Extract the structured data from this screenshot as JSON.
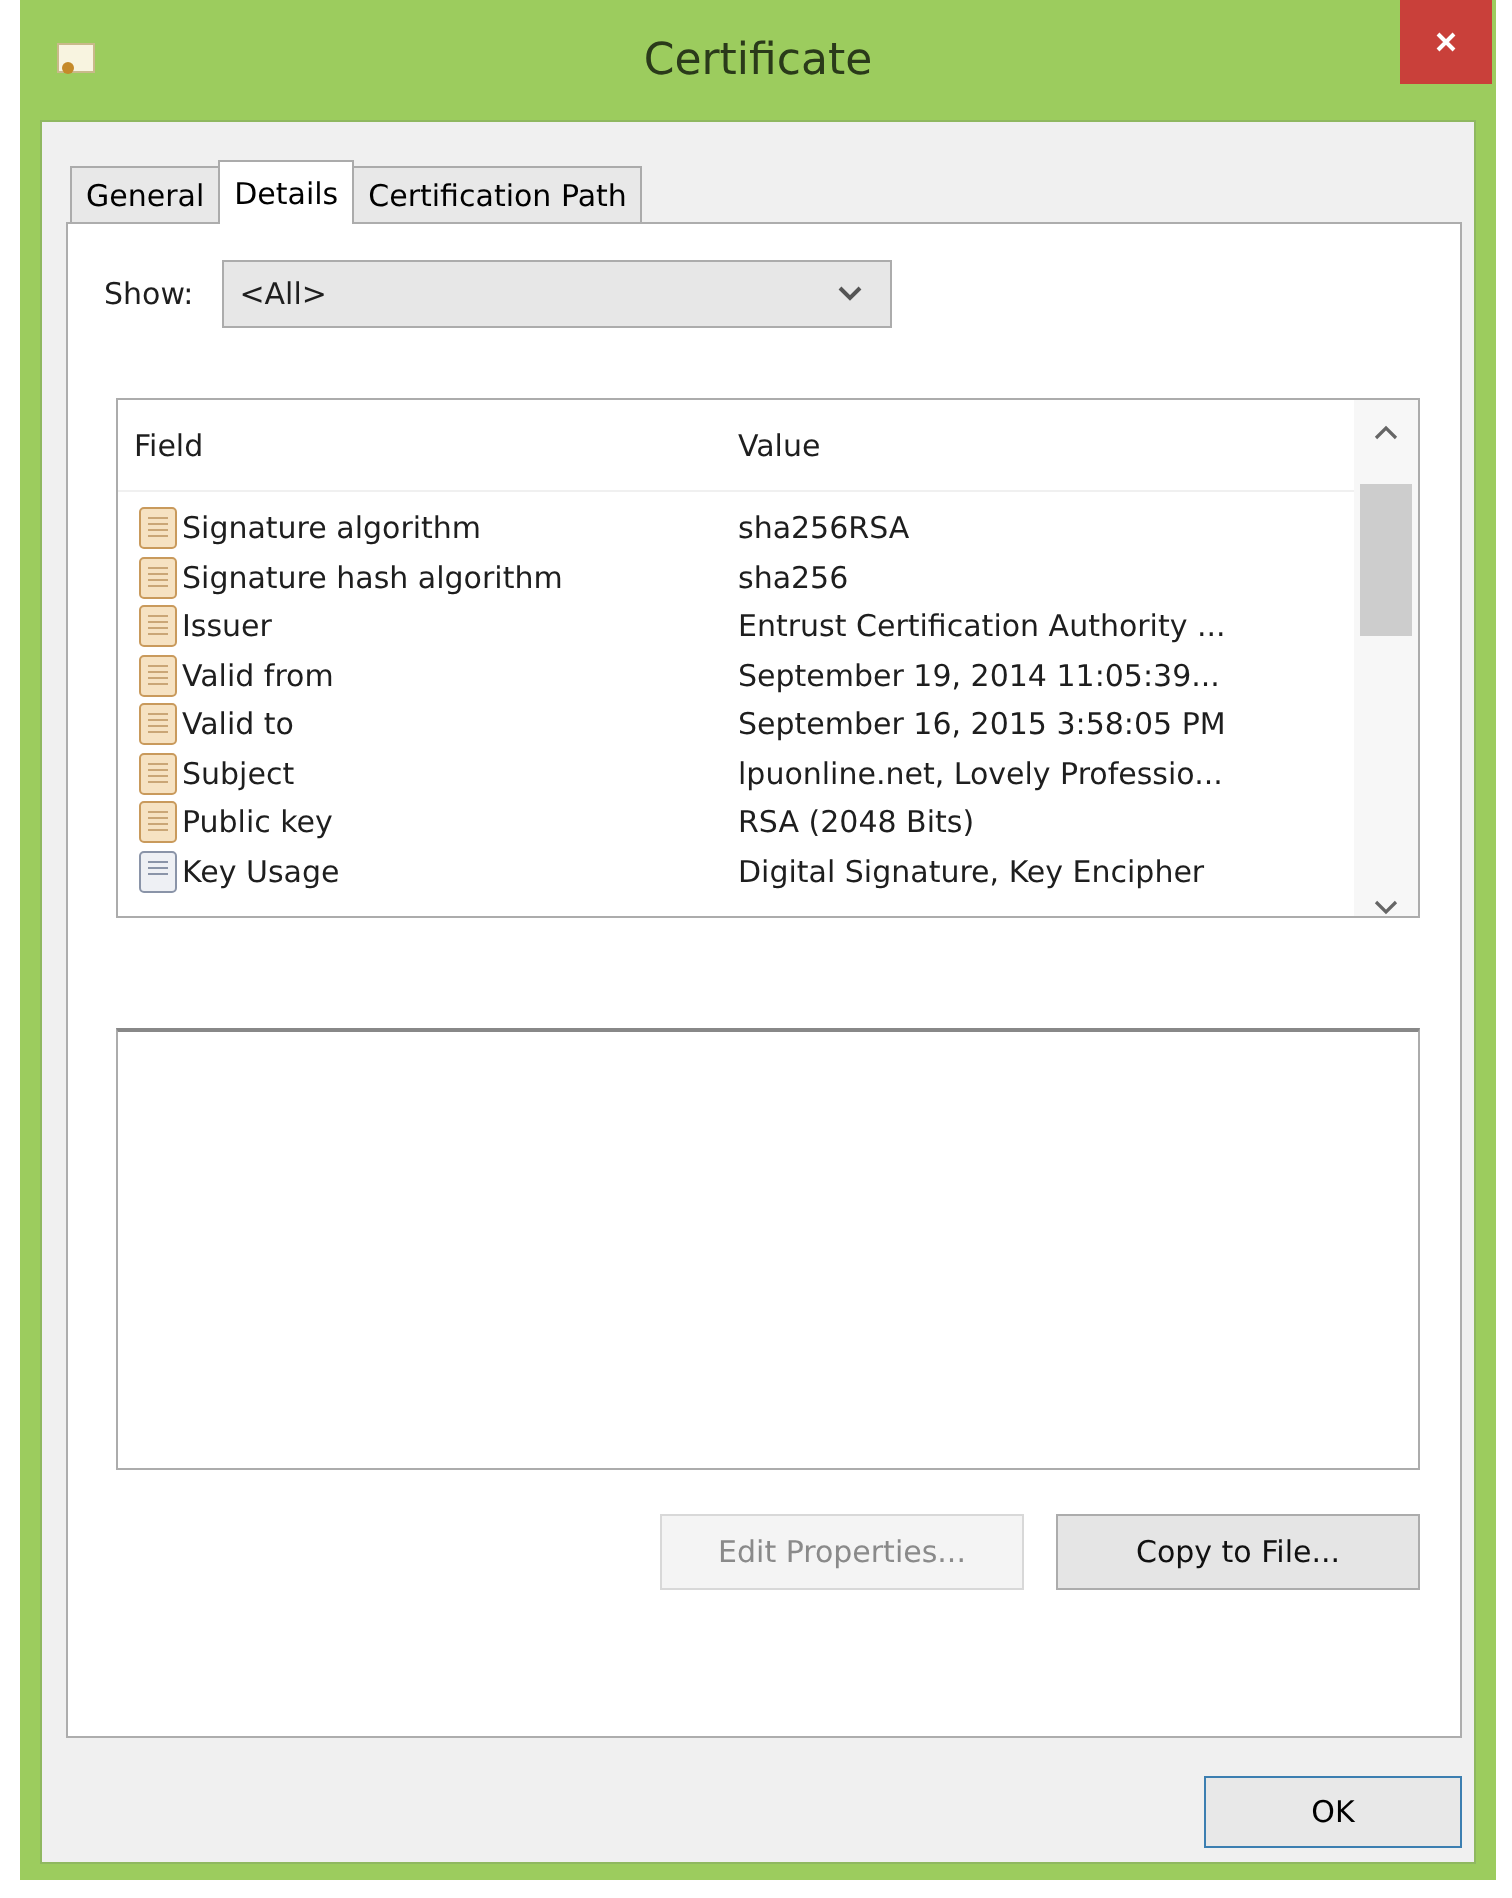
{
  "window": {
    "title": "Certificate"
  },
  "tabs": [
    {
      "label": "General",
      "selected": false
    },
    {
      "label": "Details",
      "selected": true
    },
    {
      "label": "Certification Path",
      "selected": false
    }
  ],
  "show": {
    "label": "Show:",
    "value": "<All>"
  },
  "table": {
    "columns": [
      "Field",
      "Value"
    ],
    "rows": [
      {
        "kind": "field",
        "field": "Signature algorithm",
        "value": "sha256RSA"
      },
      {
        "kind": "field",
        "field": "Signature hash algorithm",
        "value": "sha256"
      },
      {
        "kind": "field",
        "field": "Issuer",
        "value": "Entrust Certification Authority ..."
      },
      {
        "kind": "field",
        "field": "Valid from",
        "value": "September 19, 2014 11:05:39..."
      },
      {
        "kind": "field",
        "field": "Valid to",
        "value": "September 16, 2015 3:58:05 PM"
      },
      {
        "kind": "field",
        "field": "Subject",
        "value": "lpuonline.net, Lovely Professio..."
      },
      {
        "kind": "field",
        "field": "Public key",
        "value": "RSA (2048 Bits)"
      },
      {
        "kind": "extension",
        "field": "Key Usage",
        "value": "Digital Signature, Key Encipher"
      }
    ]
  },
  "buttons": [
    {
      "label": "Edit Properties...",
      "disabled": true
    },
    {
      "label": "Copy to File...",
      "disabled": false
    }
  ],
  "ok": "OK"
}
